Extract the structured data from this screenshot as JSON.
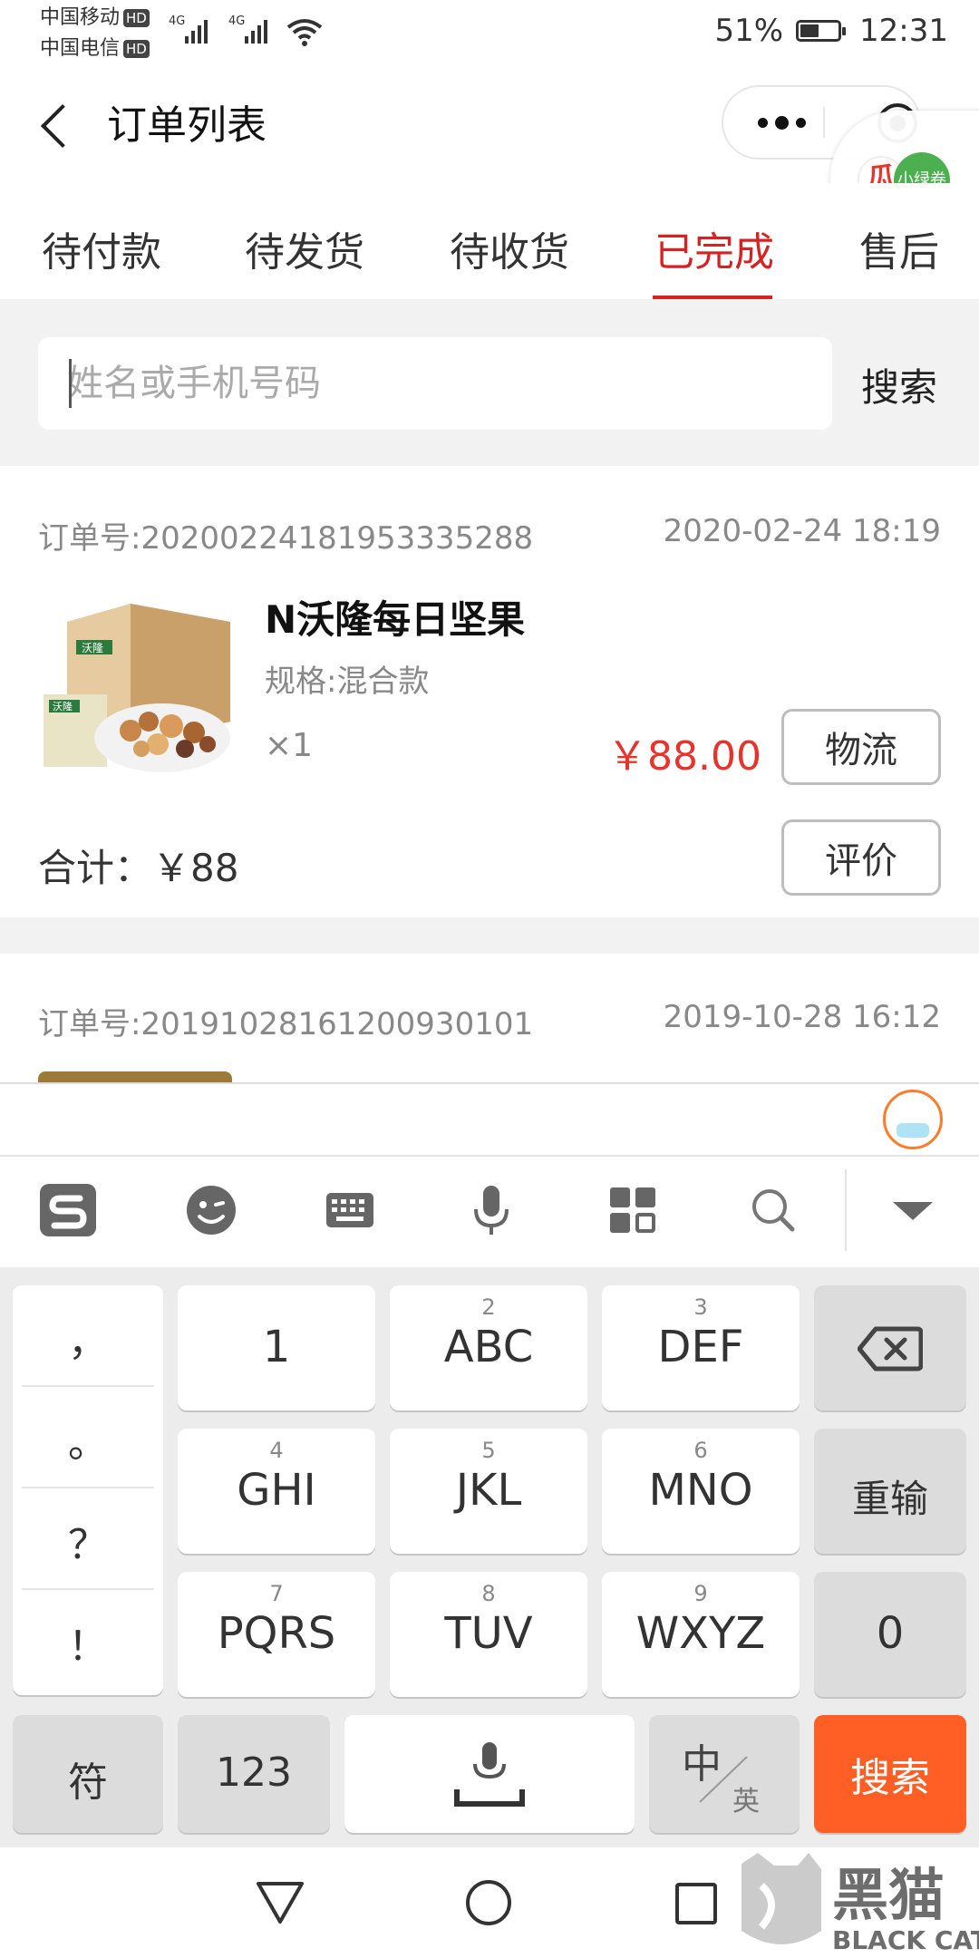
{
  "status_bar": {
    "carrier1": "中国移动",
    "carrier2": "中国电信",
    "hd": "HD",
    "net": "4G",
    "battery_text": "51%",
    "battery_level": 0.51,
    "time": "12:31"
  },
  "nav": {
    "title": "订单列表"
  },
  "float_plugin": {
    "label": "小绿卷"
  },
  "tabs": [
    {
      "label": "待付款"
    },
    {
      "label": "待发货"
    },
    {
      "label": "待收货"
    },
    {
      "label": "已完成"
    },
    {
      "label": "售后"
    }
  ],
  "search": {
    "placeholder": "姓名或手机号码",
    "button": "搜索"
  },
  "orders": [
    {
      "order_no": "订单号:20200224181953335288",
      "time": "2020-02-24 18:19",
      "product_name": "N沃隆每日坚果",
      "spec": "规格:混合款",
      "qty": "×1",
      "price": "￥88.00",
      "logistics_button": "物流",
      "total": "合计：￥88",
      "review_button": "评价",
      "product_box_brand": "沃隆",
      "product_pack_brand": "沃隆"
    },
    {
      "order_no": "订单号:20191028161200930101",
      "time": "2019-10-28 16:12"
    }
  ],
  "keyboard": {
    "toolbar_icons": [
      "sogou-logo-icon",
      "emoji-icon",
      "keyboard-icon",
      "microphone-icon",
      "apps-grid-icon",
      "search-icon",
      "collapse-icon"
    ],
    "punctuation": [
      "，",
      "。",
      "？",
      "！"
    ],
    "keys": [
      {
        "main": "1",
        "sub": ""
      },
      {
        "main": "ABC",
        "sub": "2"
      },
      {
        "main": "DEF",
        "sub": "3"
      },
      {
        "main": "GHI",
        "sub": "4"
      },
      {
        "main": "JKL",
        "sub": "5"
      },
      {
        "main": "MNO",
        "sub": "6"
      },
      {
        "main": "PQRS",
        "sub": "7"
      },
      {
        "main": "TUV",
        "sub": "8"
      },
      {
        "main": "WXYZ",
        "sub": "9"
      }
    ],
    "reinput": "重输",
    "zero": "0",
    "symbols": "符",
    "num": "123",
    "lang_zh": "中",
    "lang_en": "英",
    "search": "搜索"
  },
  "watermark": {
    "text_cn": "黑猫",
    "text_en": "BLACK CAT"
  },
  "colors": {
    "accent_red": "#d62222",
    "price_red": "#e8332c",
    "search_key": "#ff5f24"
  }
}
